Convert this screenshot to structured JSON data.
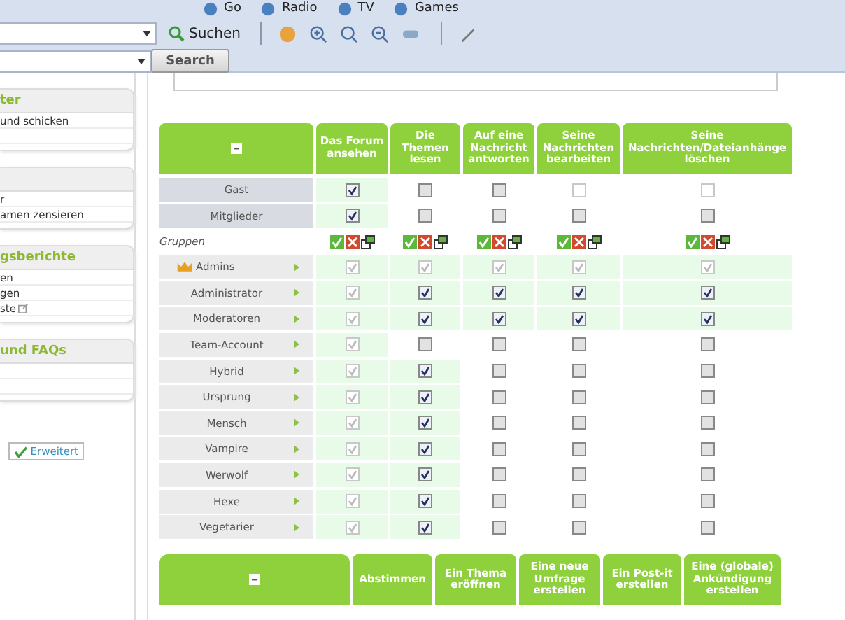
{
  "toolbar": {
    "links": [
      "Go",
      "Radio",
      "TV",
      "Games"
    ],
    "search_button": "Suchen",
    "web_search_button": "Search"
  },
  "sidebar": [
    {
      "title": "ter",
      "items": [
        {
          "text": "und schicken"
        }
      ]
    },
    {
      "items": [
        {
          "text": "r"
        },
        {
          "text": "amen zensieren"
        }
      ]
    },
    {
      "title": "gsberichte",
      "items": [
        {
          "text": "en"
        },
        {
          "text": "gen"
        },
        {
          "text": "ste",
          "external": true
        }
      ]
    },
    {
      "title": "und FAQs"
    }
  ],
  "advanced_button": "Erweitert",
  "permissions": {
    "columns": [
      "Das Forum ansehen",
      "Die Themen lesen",
      "Auf eine Nachricht antworten",
      "Seine Nachrichten bearbeiten",
      "Seine Nachrichten/Dateianhänge löschen"
    ],
    "rows": [
      {
        "label": "Gast",
        "kind": "base",
        "cells": [
          {
            "checked": true,
            "disabled": false
          },
          {
            "checked": false,
            "disabled": false
          },
          {
            "checked": false,
            "disabled": false
          },
          {
            "checked": false,
            "disabled": true
          },
          {
            "checked": false,
            "disabled": true
          }
        ]
      },
      {
        "label": "Mitglieder",
        "kind": "base",
        "cells": [
          {
            "checked": true,
            "disabled": false
          },
          {
            "checked": false,
            "disabled": false
          },
          {
            "checked": false,
            "disabled": false
          },
          {
            "checked": false,
            "disabled": false
          },
          {
            "checked": false,
            "disabled": false
          }
        ]
      },
      {
        "label": "Gruppen",
        "kind": "tools",
        "cells": []
      },
      {
        "label": "Admins",
        "kind": "leader",
        "cells": [
          {
            "checked": true,
            "disabled": true
          },
          {
            "checked": true,
            "disabled": true
          },
          {
            "checked": true,
            "disabled": true
          },
          {
            "checked": true,
            "disabled": true
          },
          {
            "checked": true,
            "disabled": true
          }
        ]
      },
      {
        "label": "Administrator",
        "kind": "group",
        "cells": [
          {
            "checked": true,
            "disabled": true
          },
          {
            "checked": true,
            "disabled": false
          },
          {
            "checked": true,
            "disabled": false
          },
          {
            "checked": true,
            "disabled": false
          },
          {
            "checked": true,
            "disabled": false
          }
        ]
      },
      {
        "label": "Moderatoren",
        "kind": "group",
        "cells": [
          {
            "checked": true,
            "disabled": true
          },
          {
            "checked": true,
            "disabled": false
          },
          {
            "checked": true,
            "disabled": false
          },
          {
            "checked": true,
            "disabled": false
          },
          {
            "checked": true,
            "disabled": false
          }
        ]
      },
      {
        "label": "Team-Account",
        "kind": "group",
        "cells": [
          {
            "checked": true,
            "disabled": true
          },
          {
            "checked": false,
            "disabled": false
          },
          {
            "checked": false,
            "disabled": false
          },
          {
            "checked": false,
            "disabled": false
          },
          {
            "checked": false,
            "disabled": false
          }
        ]
      },
      {
        "label": "Hybrid",
        "kind": "group",
        "cells": [
          {
            "checked": true,
            "disabled": true
          },
          {
            "checked": true,
            "disabled": false
          },
          {
            "checked": false,
            "disabled": false
          },
          {
            "checked": false,
            "disabled": false
          },
          {
            "checked": false,
            "disabled": false
          }
        ]
      },
      {
        "label": "Ursprung",
        "kind": "group",
        "cells": [
          {
            "checked": true,
            "disabled": true
          },
          {
            "checked": true,
            "disabled": false
          },
          {
            "checked": false,
            "disabled": false
          },
          {
            "checked": false,
            "disabled": false
          },
          {
            "checked": false,
            "disabled": false
          }
        ]
      },
      {
        "label": "Mensch",
        "kind": "group",
        "cells": [
          {
            "checked": true,
            "disabled": true
          },
          {
            "checked": true,
            "disabled": false
          },
          {
            "checked": false,
            "disabled": false
          },
          {
            "checked": false,
            "disabled": false
          },
          {
            "checked": false,
            "disabled": false
          }
        ]
      },
      {
        "label": "Vampire",
        "kind": "group",
        "cells": [
          {
            "checked": true,
            "disabled": true
          },
          {
            "checked": true,
            "disabled": false
          },
          {
            "checked": false,
            "disabled": false
          },
          {
            "checked": false,
            "disabled": false
          },
          {
            "checked": false,
            "disabled": false
          }
        ]
      },
      {
        "label": "Werwolf",
        "kind": "group",
        "cells": [
          {
            "checked": true,
            "disabled": true
          },
          {
            "checked": true,
            "disabled": false
          },
          {
            "checked": false,
            "disabled": false
          },
          {
            "checked": false,
            "disabled": false
          },
          {
            "checked": false,
            "disabled": false
          }
        ]
      },
      {
        "label": "Hexe",
        "kind": "group",
        "cells": [
          {
            "checked": true,
            "disabled": true
          },
          {
            "checked": true,
            "disabled": false
          },
          {
            "checked": false,
            "disabled": false
          },
          {
            "checked": false,
            "disabled": false
          },
          {
            "checked": false,
            "disabled": false
          }
        ]
      },
      {
        "label": "Vegetarier",
        "kind": "group",
        "cells": [
          {
            "checked": true,
            "disabled": true
          },
          {
            "checked": true,
            "disabled": false
          },
          {
            "checked": false,
            "disabled": false
          },
          {
            "checked": false,
            "disabled": false
          },
          {
            "checked": false,
            "disabled": false
          }
        ]
      }
    ]
  },
  "permissions_2": {
    "columns": [
      "Abstimmen",
      "Ein Thema eröffnen",
      "Eine neue Umfrage erstellen",
      "Ein Post-it erstellen",
      "Eine (globale) Ankündigung erstellen"
    ]
  }
}
